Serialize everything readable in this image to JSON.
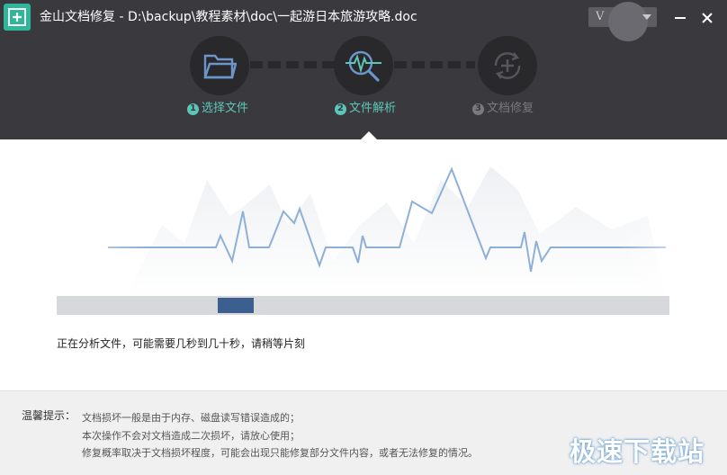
{
  "window": {
    "title": "金山文档修复 - D:\\backup\\教程素材\\doc\\一起游日本旅游攻略.doc",
    "vip_badge": "V"
  },
  "steps": [
    {
      "num": "1",
      "label": "选择文件",
      "icon": "folder-icon",
      "state": "done"
    },
    {
      "num": "2",
      "label": "文件解析",
      "icon": "analyze-icon",
      "state": "active"
    },
    {
      "num": "3",
      "label": "文档修复",
      "icon": "repair-icon",
      "state": "inactive"
    }
  ],
  "progress": {
    "value": 0.28
  },
  "status_text": "正在分析文件，可能需要几秒到几十秒，请稍等片刻",
  "tips": {
    "label": "温馨提示：",
    "lines": [
      "文档损坏一般是由于内存、磁盘读写错误造成的；",
      "本次操作不会对文档造成二次损坏，请放心使用；",
      "修复概率取决于文档损坏程度，可能会出现只能修复部分文件内容，或者无法修复的情况。"
    ]
  },
  "watermark": "极速下载站",
  "colors": {
    "accent": "#5cc7b8",
    "header_bg": "#3a3a3e",
    "progress_thumb": "#3d5f8f",
    "app_icon": "#2fb79b"
  }
}
